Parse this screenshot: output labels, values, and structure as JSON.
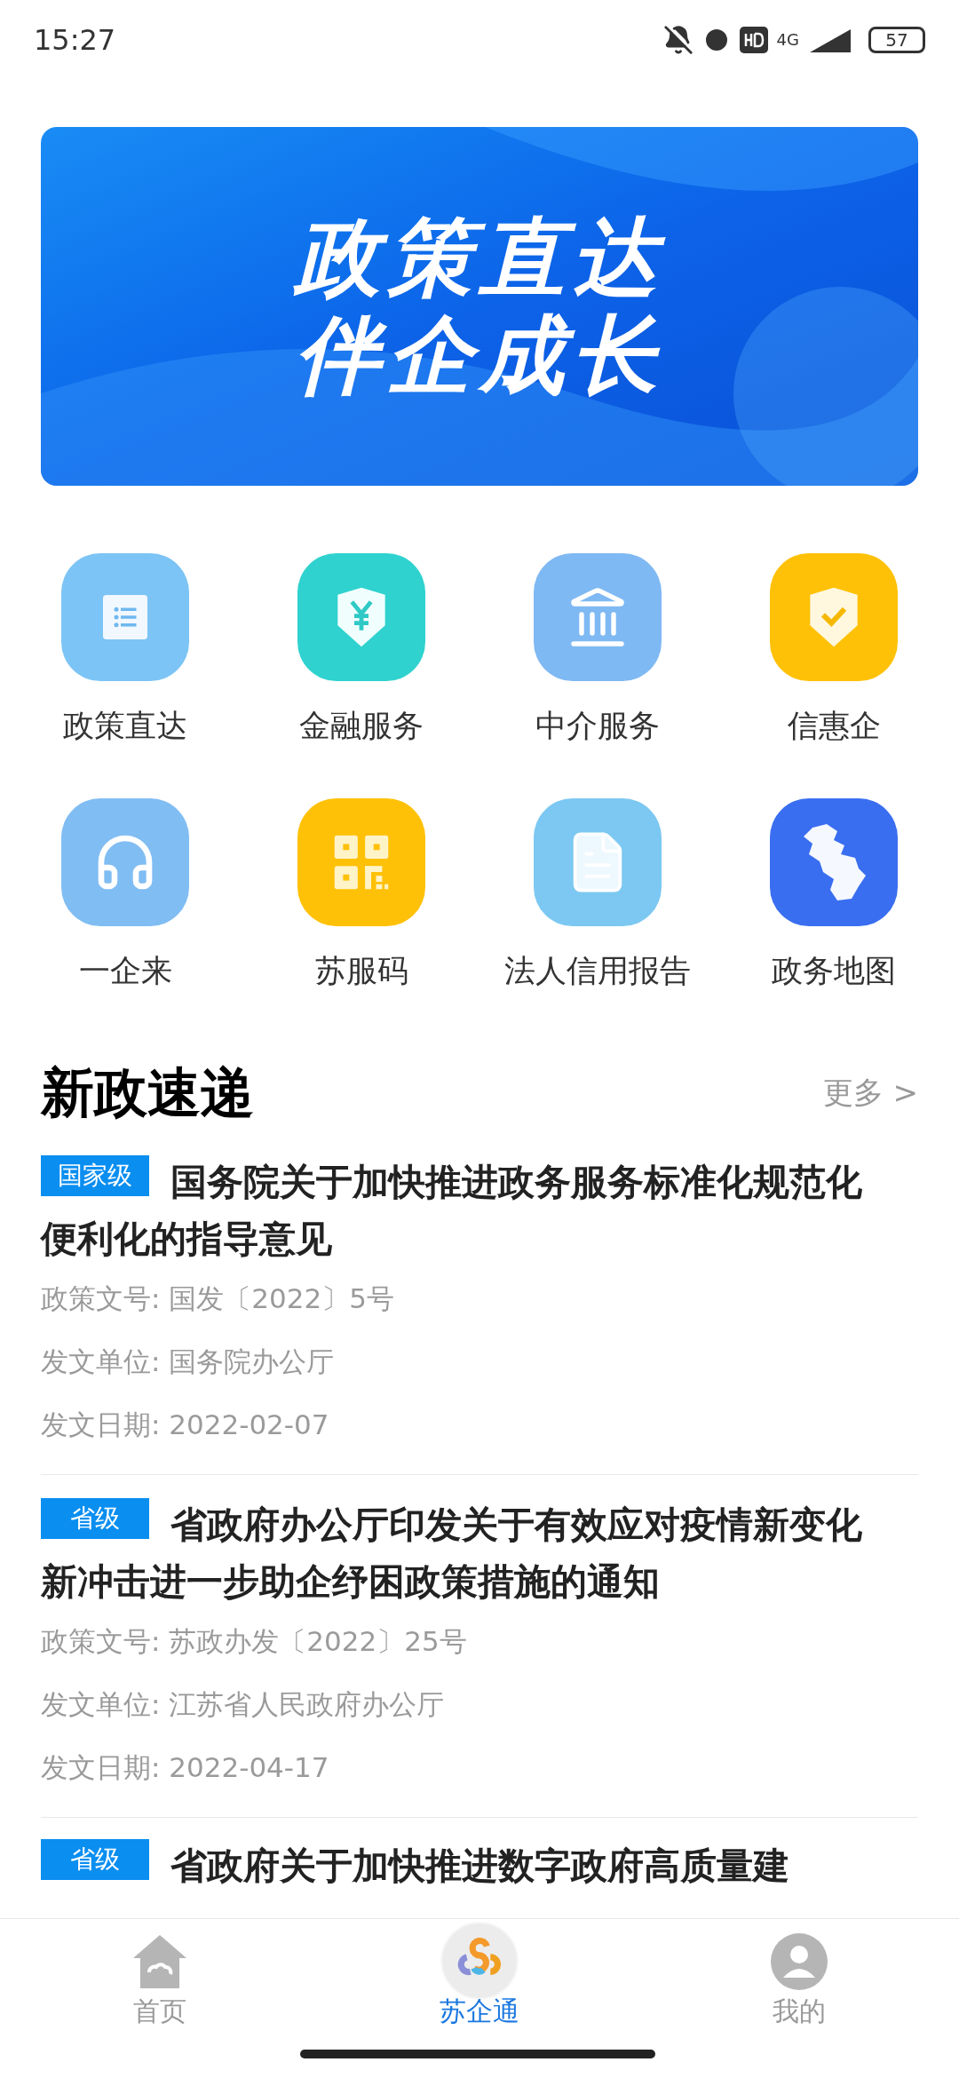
{
  "status_bar": {
    "time": "15:27",
    "network": "4G",
    "battery": "57"
  },
  "banner": {
    "lines": [
      "政策直达",
      "伴企成长"
    ]
  },
  "services": [
    {
      "label": "政策直达",
      "color": "#7cc4f5"
    },
    {
      "label": "金融服务",
      "color": "#2fd2cf"
    },
    {
      "label": "中介服务",
      "color": "#7fb9f3"
    },
    {
      "label": "信惠企",
      "color": "#ffc107"
    },
    {
      "label": "一企来",
      "color": "#80bdf3"
    },
    {
      "label": "苏服码",
      "color": "#ffc107"
    },
    {
      "label": "法人信用报告",
      "color": "#7cc8f2"
    },
    {
      "label": "政务地图",
      "color": "#3a6ef0"
    }
  ],
  "news_section": {
    "title": "新政速递",
    "more": "更多 >"
  },
  "news": [
    {
      "tag": "国家级",
      "title_lines": [
        "国务院关于加快推进政务服务标准化规范化",
        "便利化的指导意见"
      ],
      "meta": [
        "政策文号: 国发〔2022〕5号",
        "发文单位: 国务院办公厅",
        "发文日期: 2022-02-07"
      ]
    },
    {
      "tag": "省级",
      "title_lines": [
        "省政府办公厅印发关于有效应对疫情新变化",
        "新冲击进一步助企纾困政策措施的通知"
      ],
      "meta": [
        "政策文号: 苏政办发〔2022〕25号",
        "发文单位: 江苏省人民政府办公厅",
        "发文日期: 2022-04-17"
      ]
    },
    {
      "tag": "省级",
      "title_lines": [
        "省政府关于加快推进数字政府高质量建"
      ]
    }
  ],
  "bottom_nav": [
    {
      "label": "首页",
      "kind": "home",
      "selected": false
    },
    {
      "label": "苏企通",
      "kind": "logo",
      "selected": true
    },
    {
      "label": "我的",
      "kind": "profile",
      "selected": false
    }
  ]
}
